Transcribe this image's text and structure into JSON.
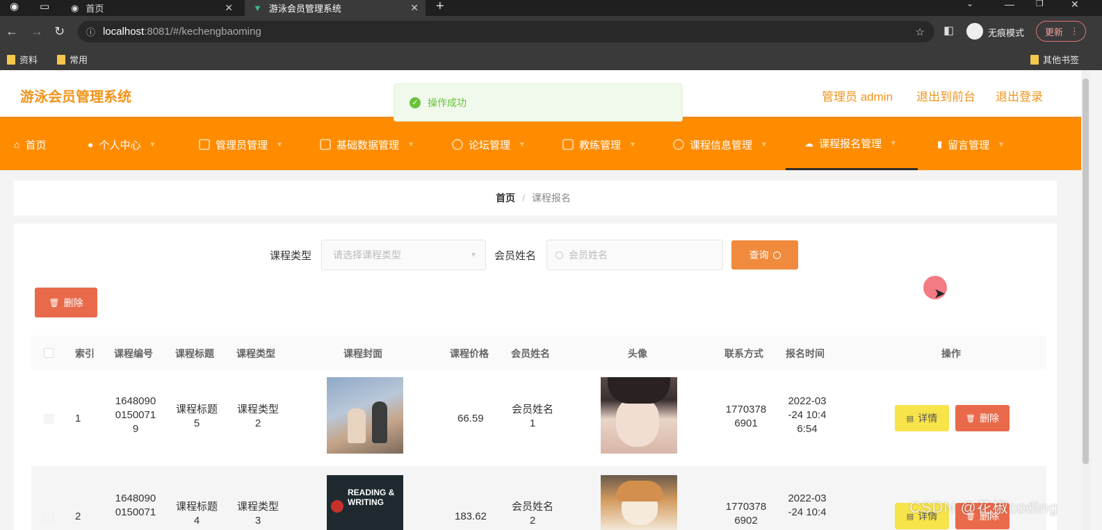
{
  "browser": {
    "tabs": [
      {
        "title": "首页"
      },
      {
        "title": "游泳会员管理系统"
      }
    ],
    "url_host": "localhost",
    "url_path": ":8081/#/kechengbaoming",
    "incognito": "无痕模式",
    "update": "更新",
    "bookmarks": [
      "资料",
      "常用"
    ],
    "other_bookmarks": "其他书签"
  },
  "header": {
    "logo": "游泳会员管理系统",
    "admin": "管理员 admin",
    "to_front": "退出到前台",
    "logout": "退出登录"
  },
  "toast": "操作成功",
  "nav": [
    {
      "label": "首页"
    },
    {
      "label": "个人中心"
    },
    {
      "label": "管理员管理"
    },
    {
      "label": "基础数据管理"
    },
    {
      "label": "论坛管理"
    },
    {
      "label": "教练管理"
    },
    {
      "label": "课程信息管理"
    },
    {
      "label": "课程报名管理"
    },
    {
      "label": "留言管理"
    }
  ],
  "breadcrumb": {
    "home": "首页",
    "sep": "/",
    "current": "课程报名"
  },
  "search": {
    "type_label": "课程类型",
    "type_placeholder": "请选择课程类型",
    "name_label": "会员姓名",
    "name_placeholder": "会员姓名",
    "query": "查询",
    "delete": "删除"
  },
  "table": {
    "columns": [
      "索引",
      "课程编号",
      "课程标题",
      "课程类型",
      "课程封面",
      "课程价格",
      "会员姓名",
      "头像",
      "联系方式",
      "报名时间",
      "操作"
    ],
    "detail": "详情",
    "delete": "删除",
    "rows": [
      {
        "index": "1",
        "code": [
          "1648090",
          "0150071",
          "9"
        ],
        "title": [
          "课程标题",
          "5"
        ],
        "type": [
          "课程类型",
          "2"
        ],
        "price": "66.59",
        "member": [
          "会员姓名",
          "1"
        ],
        "phone": [
          "1770378",
          "6901"
        ],
        "time": [
          "2022-03",
          "-24 10:4",
          "6:54"
        ]
      },
      {
        "index": "2",
        "code": [
          "1648090",
          "0150071",
          ""
        ],
        "title": [
          "课程标题",
          "4"
        ],
        "type": [
          "课程类型",
          "3"
        ],
        "price": "183.62",
        "member": [
          "会员姓名",
          "2"
        ],
        "phone": [
          "1770378",
          "6902"
        ],
        "time": [
          "2022-03",
          "-24 10:4",
          ""
        ]
      }
    ]
  },
  "watermark": "CSDN @花椒coding",
  "cover2_text": [
    "READING &",
    "WRITING"
  ]
}
